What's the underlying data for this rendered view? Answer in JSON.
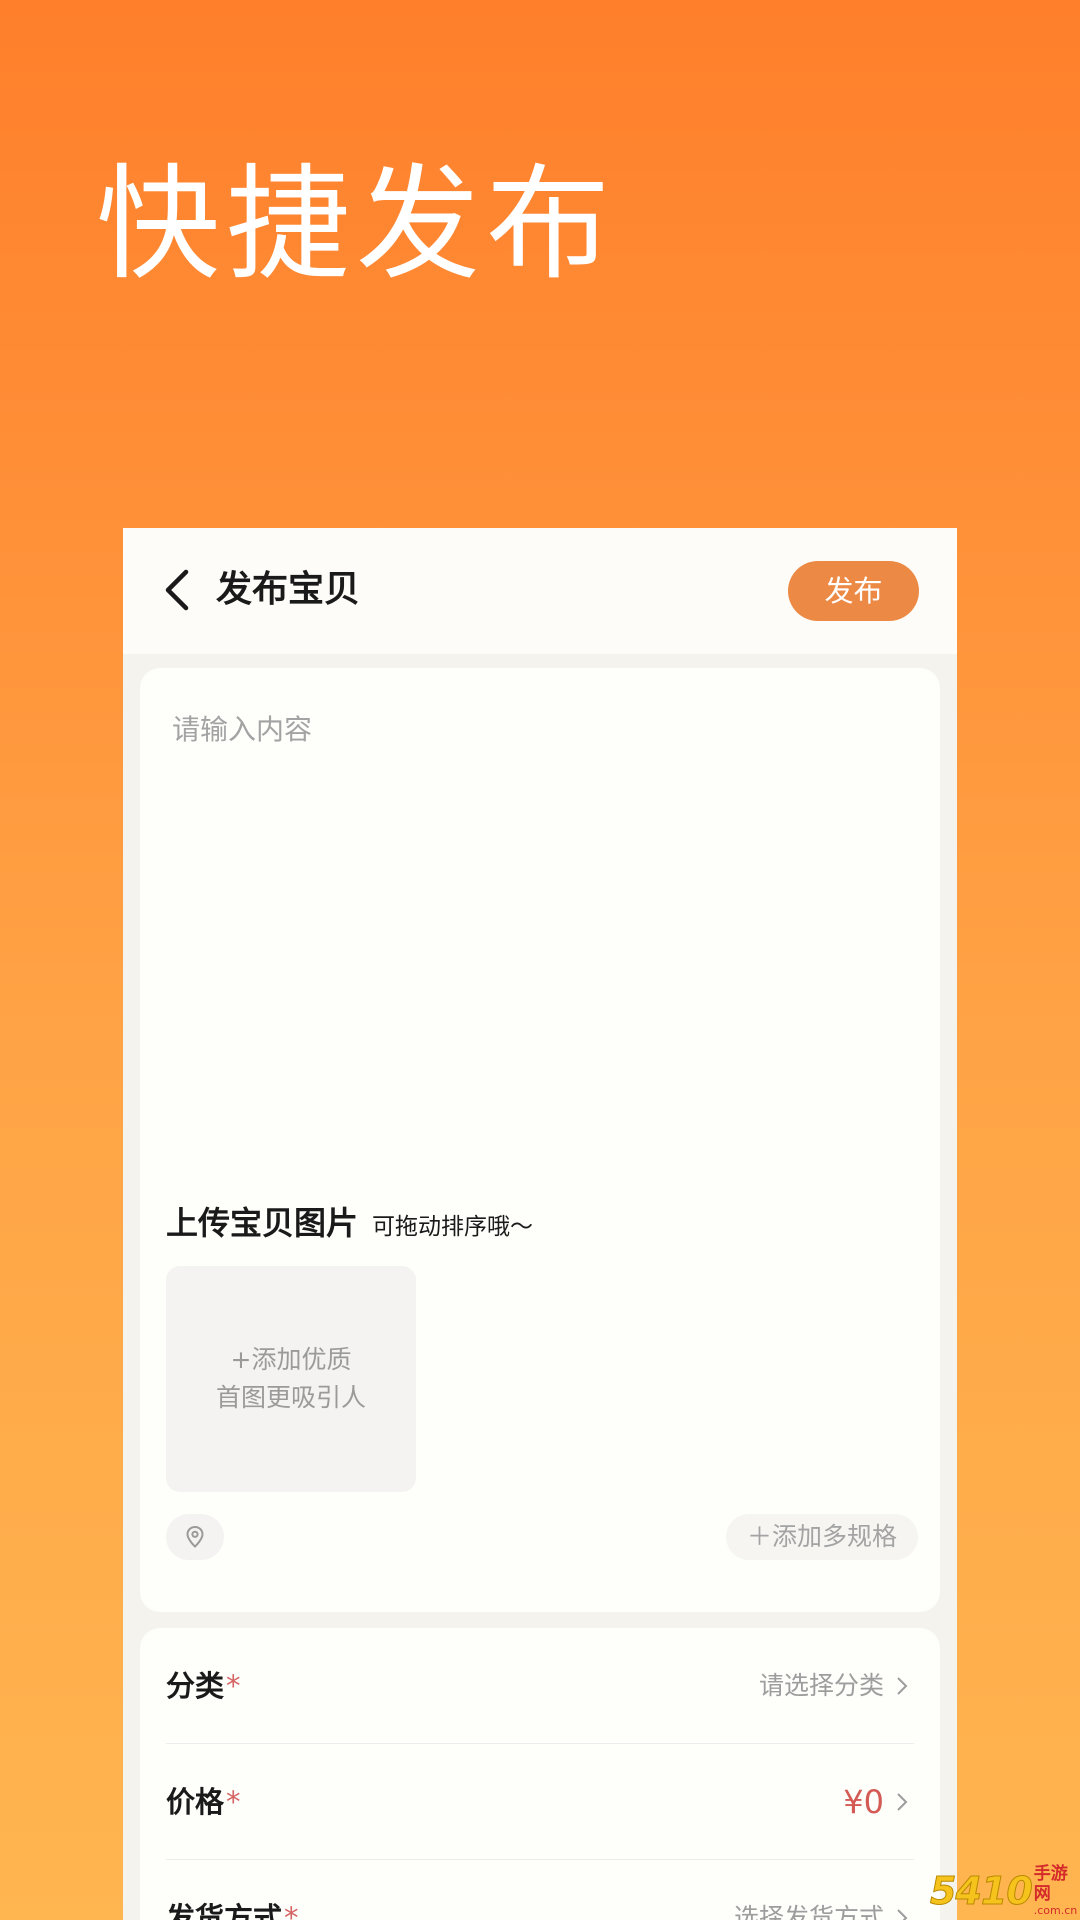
{
  "promo": {
    "title": "快捷发布"
  },
  "nav": {
    "title": "发布宝贝",
    "publish_label": "发布"
  },
  "content": {
    "placeholder": "请输入内容"
  },
  "upload": {
    "title": "上传宝贝图片",
    "hint": "可拖动排序哦～",
    "box_line1": "+添加优质",
    "box_line2": "首图更吸引人",
    "spec_label": "＋添加多规格"
  },
  "form": {
    "rows": [
      {
        "label": "分类",
        "required": "*",
        "value": "请选择分类"
      },
      {
        "label": "价格",
        "required": "*",
        "value": "¥0"
      },
      {
        "label": "发货方式",
        "required": "*",
        "value": "选择发货方式"
      }
    ]
  },
  "watermark": {
    "number": "5410",
    "name": "手游网",
    "url": ".com.cn"
  },
  "colors": {
    "accent": "#ec8945",
    "price": "#d45b55",
    "required": "#d56464",
    "bg_top": "#ff7f2b",
    "bg_bottom": "#ffb550"
  },
  "icons": [
    "back-arrow-icon",
    "location-pin-icon",
    "chevron-right-icon"
  ]
}
